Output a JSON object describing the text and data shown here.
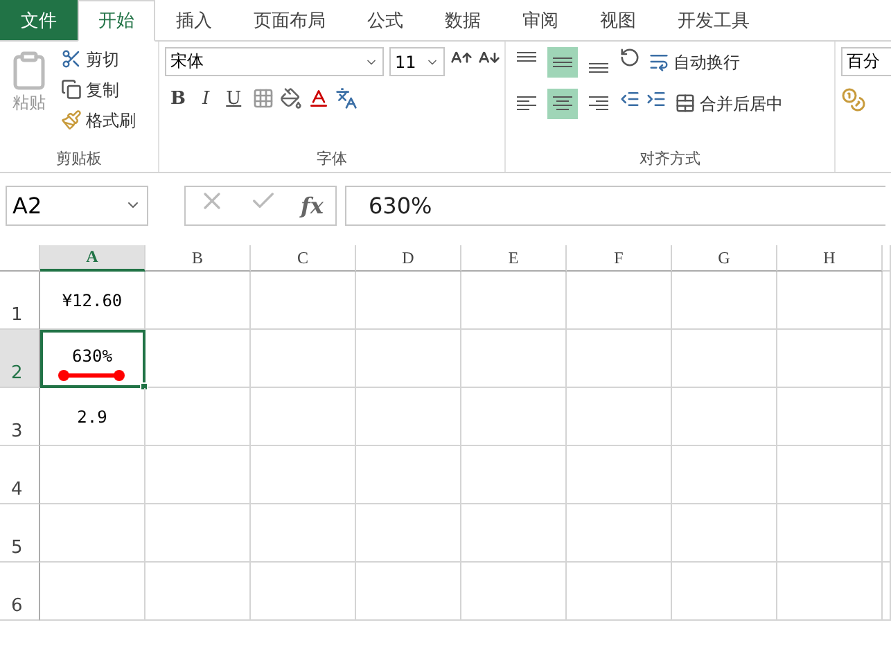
{
  "tabs": [
    {
      "label": "文件",
      "kind": "file",
      "selected": false
    },
    {
      "label": "开始",
      "kind": "tab",
      "selected": true
    },
    {
      "label": "插入",
      "kind": "tab",
      "selected": false
    },
    {
      "label": "页面布局",
      "kind": "tab",
      "selected": false
    },
    {
      "label": "公式",
      "kind": "tab",
      "selected": false
    },
    {
      "label": "数据",
      "kind": "tab",
      "selected": false
    },
    {
      "label": "审阅",
      "kind": "tab",
      "selected": false
    },
    {
      "label": "视图",
      "kind": "tab",
      "selected": false
    },
    {
      "label": "开发工具",
      "kind": "tab",
      "selected": false
    }
  ],
  "clipboard": {
    "paste": "粘贴",
    "cut": "剪切",
    "copy": "复制",
    "format_painter": "格式刷",
    "title": "剪贴板"
  },
  "font": {
    "name": "宋体",
    "size": "11",
    "bold": "B",
    "italic": "I",
    "underline": "U",
    "title": "字体"
  },
  "alignment": {
    "vertical": [
      {
        "selected": false
      },
      {
        "selected": true
      },
      {
        "selected": false
      }
    ],
    "horizontal": [
      {
        "selected": false
      },
      {
        "selected": true
      },
      {
        "selected": false
      }
    ],
    "wrap_text": "自动换行",
    "merge_center": "合并后居中",
    "title": "对齐方式"
  },
  "number": {
    "format": "百分"
  },
  "formula_bar": {
    "name_box": "A2",
    "fx": "fx",
    "value": "630%"
  },
  "columns": [
    {
      "label": "A",
      "selected": true
    },
    {
      "label": "B",
      "selected": false
    },
    {
      "label": "C",
      "selected": false
    },
    {
      "label": "D",
      "selected": false
    },
    {
      "label": "E",
      "selected": false
    },
    {
      "label": "F",
      "selected": false
    },
    {
      "label": "G",
      "selected": false
    },
    {
      "label": "H",
      "selected": false
    }
  ],
  "rows": [
    {
      "label": "1",
      "selected": false,
      "a": "¥12.60"
    },
    {
      "label": "2",
      "selected": true,
      "a": "630%"
    },
    {
      "label": "3",
      "selected": false,
      "a": "2.9"
    },
    {
      "label": "4",
      "selected": false
    },
    {
      "label": "5",
      "selected": false
    },
    {
      "label": "6",
      "selected": false
    }
  ]
}
